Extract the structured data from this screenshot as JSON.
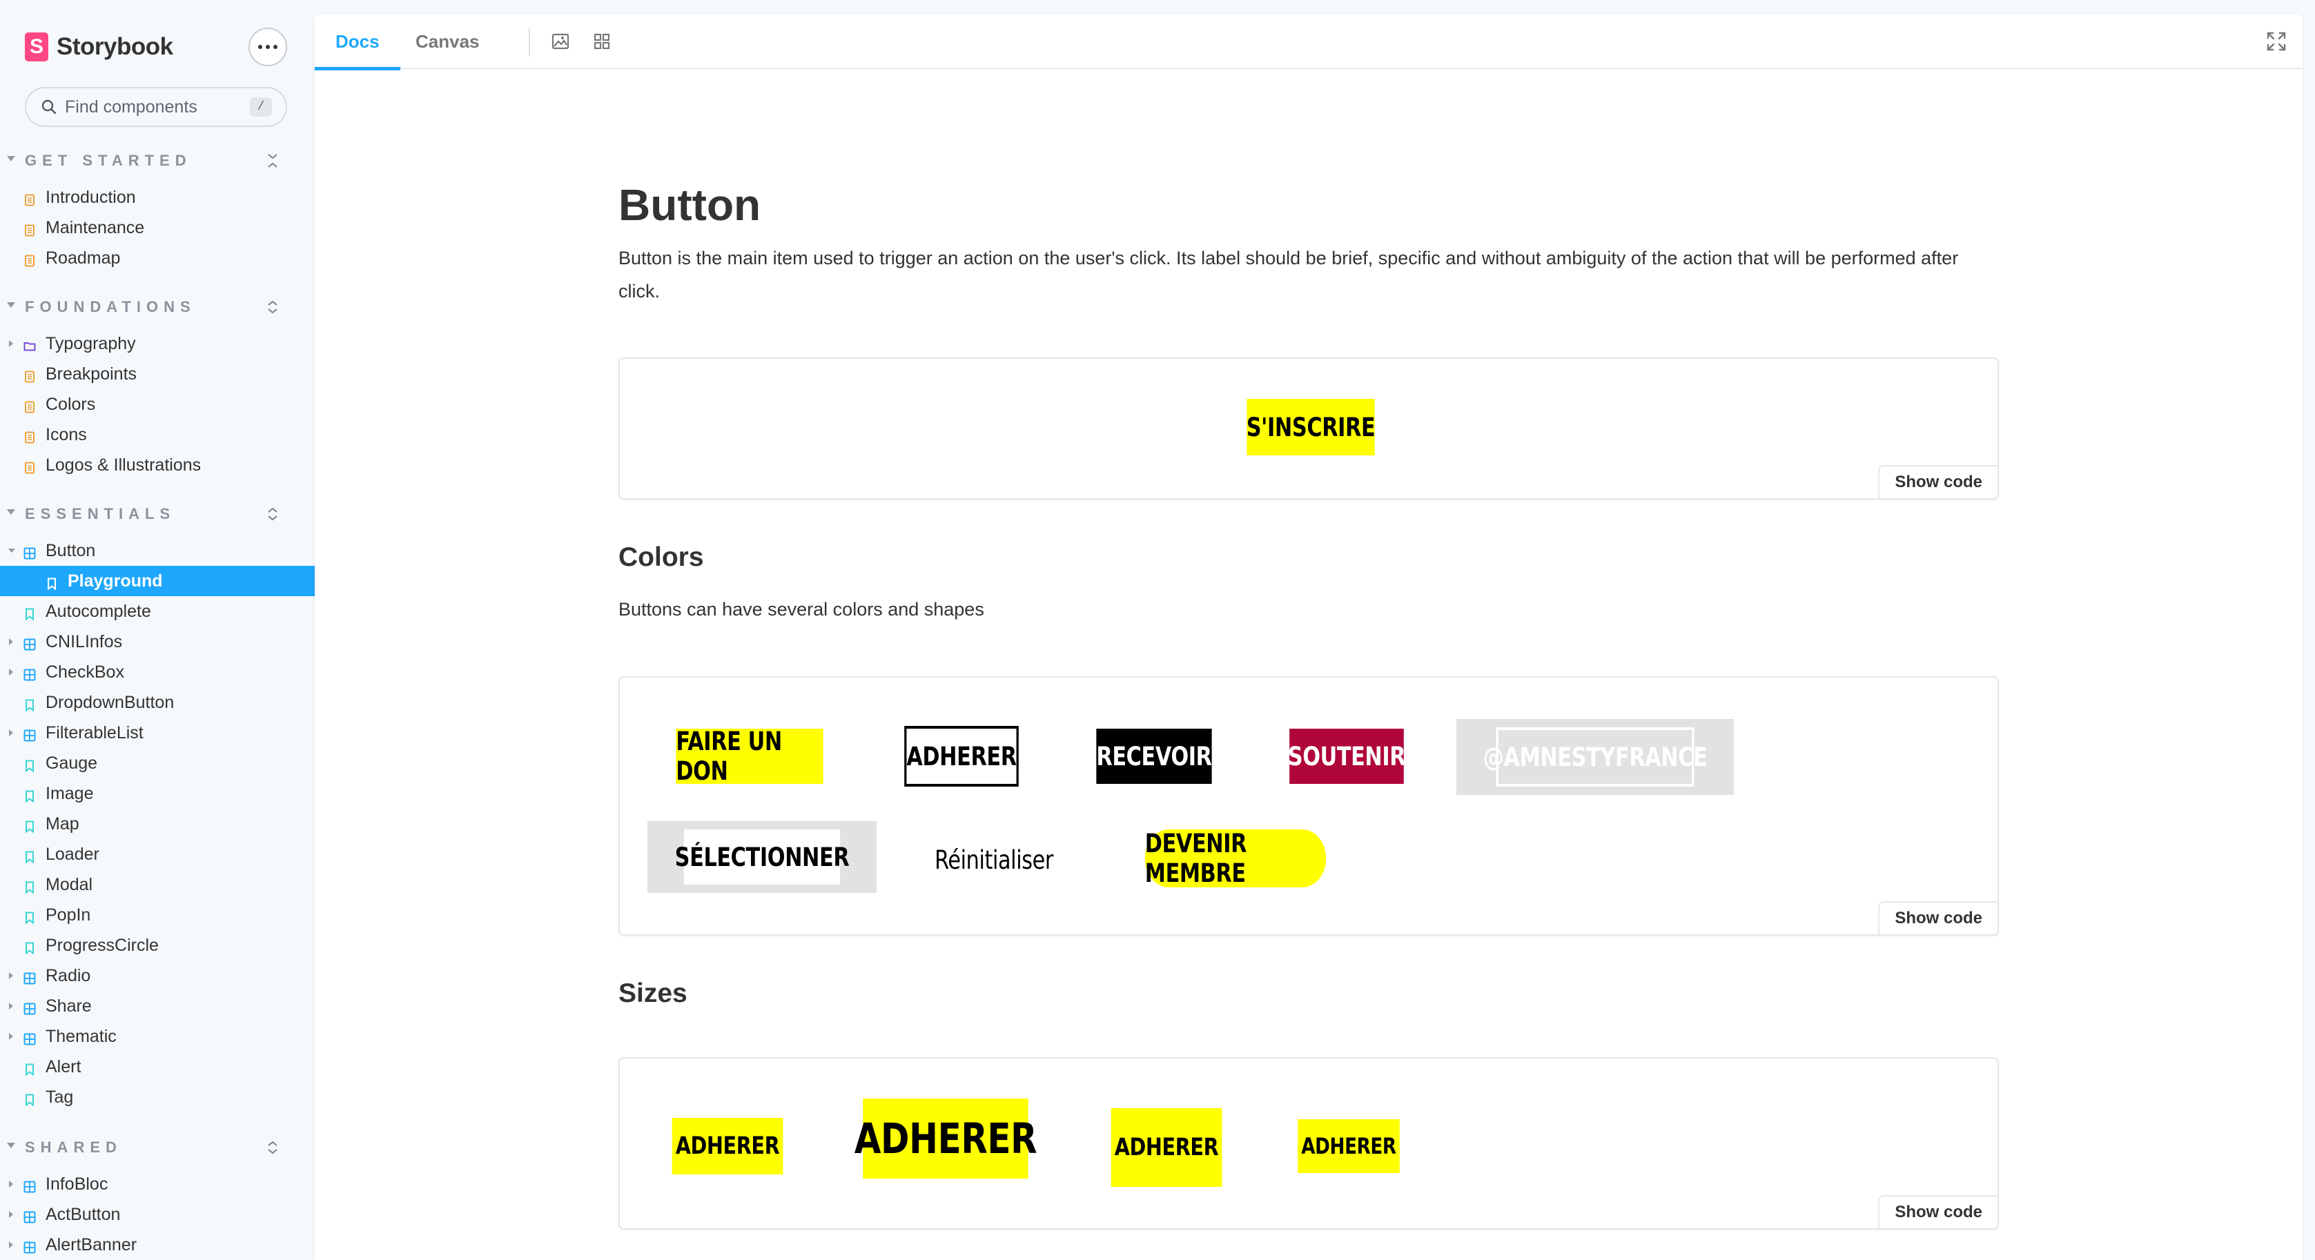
{
  "brand": {
    "name": "Storybook",
    "logo_letter": "S",
    "accent": "#ff4785"
  },
  "sidebar": {
    "search": {
      "placeholder": "Find components",
      "shortcut": "/"
    },
    "sections": [
      {
        "title": "GET STARTED",
        "items": [
          {
            "label": "Introduction",
            "icon": "document-icon"
          },
          {
            "label": "Maintenance",
            "icon": "document-icon"
          },
          {
            "label": "Roadmap",
            "icon": "document-icon"
          }
        ]
      },
      {
        "title": "FOUNDATIONS",
        "items": [
          {
            "label": "Typography",
            "icon": "folder-icon"
          },
          {
            "label": "Breakpoints",
            "icon": "document-icon"
          },
          {
            "label": "Colors",
            "icon": "document-icon"
          },
          {
            "label": "Icons",
            "icon": "document-icon"
          },
          {
            "label": "Logos & Illustrations",
            "icon": "document-icon"
          }
        ]
      },
      {
        "title": "ESSENTIALS",
        "items": [
          {
            "label": "Button",
            "icon": "component-icon"
          },
          {
            "label": "Playground",
            "icon": "bookmark-icon"
          },
          {
            "label": "Autocomplete",
            "icon": "bookmark-icon"
          },
          {
            "label": "CNILInfos",
            "icon": "component-icon"
          },
          {
            "label": "CheckBox",
            "icon": "component-icon"
          },
          {
            "label": "DropdownButton",
            "icon": "bookmark-icon"
          },
          {
            "label": "FilterableList",
            "icon": "component-icon"
          },
          {
            "label": "Gauge",
            "icon": "bookmark-icon"
          },
          {
            "label": "Image",
            "icon": "bookmark-icon"
          },
          {
            "label": "Map",
            "icon": "bookmark-icon"
          },
          {
            "label": "Loader",
            "icon": "bookmark-icon"
          },
          {
            "label": "Modal",
            "icon": "bookmark-icon"
          },
          {
            "label": "PopIn",
            "icon": "bookmark-icon"
          },
          {
            "label": "ProgressCircle",
            "icon": "bookmark-icon"
          },
          {
            "label": "Radio",
            "icon": "component-icon"
          },
          {
            "label": "Share",
            "icon": "component-icon"
          },
          {
            "label": "Thematic",
            "icon": "component-icon"
          },
          {
            "label": "Alert",
            "icon": "bookmark-icon"
          },
          {
            "label": "Tag",
            "icon": "bookmark-icon"
          }
        ]
      },
      {
        "title": "SHARED",
        "items": [
          {
            "label": "InfoBloc",
            "icon": "component-icon"
          },
          {
            "label": "ActButton",
            "icon": "component-icon"
          },
          {
            "label": "AlertBanner",
            "icon": "component-icon"
          }
        ]
      }
    ]
  },
  "toolbar": {
    "tab_docs": "Docs",
    "tab_canvas": "Canvas"
  },
  "doc": {
    "title": "Button",
    "intro": "Button is the main item used to trigger an action on the user's click. Its label should be brief, specific and without ambiguity of the action that will be performed after click.",
    "show_code": "Show code",
    "primary_example": "S'INSCRIRE",
    "colors_heading": "Colors",
    "colors_desc": "Buttons can have several colors and shapes",
    "color_buttons": [
      "FAIRE UN DON",
      "ADHERER",
      "RECEVOIR",
      "SOUTENIR",
      "@AMNESTYFRANCE",
      "SÉLECTIONNER",
      "Réinitialiser",
      "DEVENIR MEMBRE"
    ],
    "sizes_heading": "Sizes",
    "size_buttons": [
      "ADHERER",
      "ADHERER",
      "ADHERER",
      "ADHERER"
    ]
  },
  "colors": {
    "amnesty_yellow": "#ffff00",
    "black": "#000000",
    "soutenir_red": "#b0053a",
    "selected_blue": "#1ea7fd",
    "icon_orange": "#f0a039",
    "icon_blue": "#1ea7fd",
    "icon_teal": "#37d5d3",
    "icon_purple": "#774dd7"
  }
}
